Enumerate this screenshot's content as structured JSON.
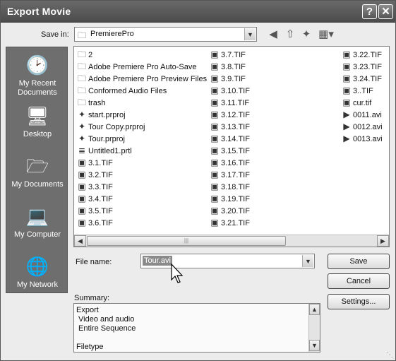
{
  "window": {
    "title": "Export Movie",
    "help_button": "?",
    "close_button": "✕"
  },
  "savein": {
    "label": "Save in:",
    "folder": "PremierePro"
  },
  "places": [
    {
      "label": "My Recent Documents",
      "icon": "recent-documents-icon"
    },
    {
      "label": "Desktop",
      "icon": "desktop-icon"
    },
    {
      "label": "My Documents",
      "icon": "my-documents-icon"
    },
    {
      "label": "My Computer",
      "icon": "my-computer-icon"
    },
    {
      "label": "My Network",
      "icon": "my-network-icon"
    }
  ],
  "columns": [
    [
      {
        "name": "2",
        "type": "folder"
      },
      {
        "name": "Adobe Premiere Pro Auto-Save",
        "type": "folder"
      },
      {
        "name": "Adobe Premiere Pro Preview Files",
        "type": "folder"
      },
      {
        "name": "Conformed Audio Files",
        "type": "folder"
      },
      {
        "name": "trash",
        "type": "folder"
      },
      {
        "name": "start.prproj",
        "type": "project"
      },
      {
        "name": "Tour Copy.prproj",
        "type": "project"
      },
      {
        "name": "Tour.prproj",
        "type": "project"
      },
      {
        "name": "Untitled1.prtl",
        "type": "title"
      },
      {
        "name": "3.1.TIF",
        "type": "image"
      },
      {
        "name": "3.2.TIF",
        "type": "image"
      },
      {
        "name": "3.3.TIF",
        "type": "image"
      },
      {
        "name": "3.4.TIF",
        "type": "image"
      },
      {
        "name": "3.5.TIF",
        "type": "image"
      },
      {
        "name": "3.6.TIF",
        "type": "image"
      }
    ],
    [
      {
        "name": "3.7.TIF",
        "type": "image"
      },
      {
        "name": "3.8.TIF",
        "type": "image"
      },
      {
        "name": "3.9.TIF",
        "type": "image"
      },
      {
        "name": "3.10.TIF",
        "type": "image"
      },
      {
        "name": "3.11.TIF",
        "type": "image"
      },
      {
        "name": "3.12.TIF",
        "type": "image"
      },
      {
        "name": "3.13.TIF",
        "type": "image"
      },
      {
        "name": "3.14.TIF",
        "type": "image"
      },
      {
        "name": "3.15.TIF",
        "type": "image"
      },
      {
        "name": "3.16.TIF",
        "type": "image"
      },
      {
        "name": "3.17.TIF",
        "type": "image"
      },
      {
        "name": "3.18.TIF",
        "type": "image"
      },
      {
        "name": "3.19.TIF",
        "type": "image"
      },
      {
        "name": "3.20.TIF",
        "type": "image"
      },
      {
        "name": "3.21.TIF",
        "type": "image"
      }
    ],
    [
      {
        "name": "3.22.TIF",
        "type": "image"
      },
      {
        "name": "3.23.TIF",
        "type": "image"
      },
      {
        "name": "3.24.TIF",
        "type": "image"
      },
      {
        "name": "3..TIF",
        "type": "image"
      },
      {
        "name": "cur.tif",
        "type": "image"
      },
      {
        "name": "0011.avi",
        "type": "video"
      },
      {
        "name": "0012.avi",
        "type": "video"
      },
      {
        "name": "0013.avi",
        "type": "video"
      }
    ]
  ],
  "filename": {
    "label": "File name:",
    "value": "Tour.avi"
  },
  "buttons": {
    "save": "Save",
    "cancel": "Cancel",
    "settings": "Settings..."
  },
  "summary": {
    "label": "Summary:",
    "lines": [
      "Export",
      "Video and audio",
      "Entire Sequence",
      "",
      "Filetype"
    ]
  },
  "colors": {
    "titlebar": "#555555",
    "places_bar": "#6e6e6e",
    "dialog_bg": "#ececec",
    "selection": "#8a8a8a"
  }
}
